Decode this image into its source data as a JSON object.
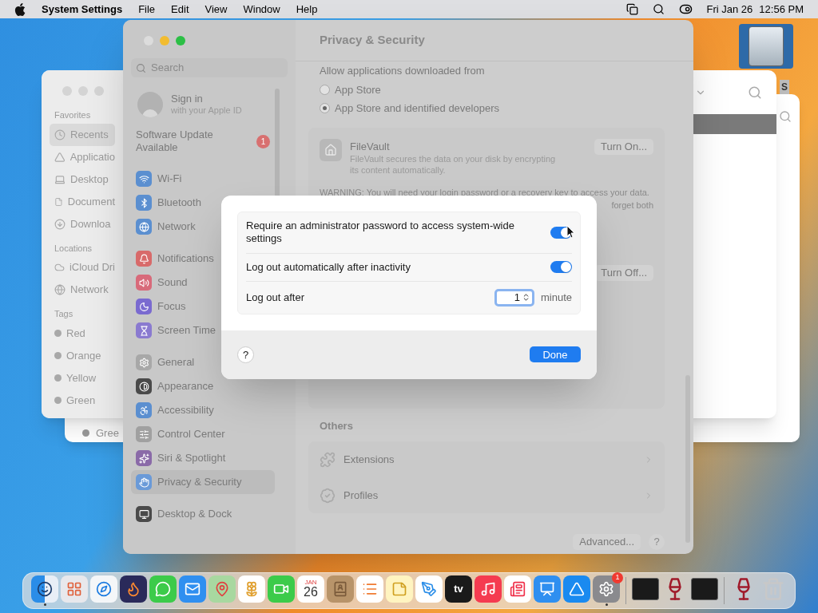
{
  "menu_bar": {
    "app_name": "System Settings",
    "menus": [
      "File",
      "Edit",
      "View",
      "Window",
      "Help"
    ],
    "date": "Fri Jan 26",
    "time": "12:56 PM"
  },
  "desktop": {
    "drive_label": "S"
  },
  "back_window": {
    "tag": "Gree"
  },
  "finder": {
    "sections": [
      {
        "title": "Favorites",
        "items": [
          {
            "label": "Recents",
            "selected": true
          },
          {
            "label": "Applicatio",
            "selected": false
          },
          {
            "label": "Desktop",
            "selected": false
          },
          {
            "label": "Document",
            "selected": false
          },
          {
            "label": "Downloa",
            "selected": false
          }
        ]
      },
      {
        "title": "Locations",
        "items": [
          {
            "label": "iCloud Dri",
            "selected": false
          },
          {
            "label": "Network",
            "selected": false
          }
        ]
      },
      {
        "title": "Tags",
        "items": [
          {
            "label": "Red",
            "selected": false
          },
          {
            "label": "Orange",
            "selected": false
          },
          {
            "label": "Yellow",
            "selected": false
          },
          {
            "label": "Green",
            "selected": false
          }
        ]
      }
    ]
  },
  "settings": {
    "title": "Privacy & Security",
    "sidebar": {
      "search_placeholder": "Search",
      "account_title": "Sign in",
      "account_subtitle": "with your Apple ID",
      "update_label": "Software Update Available",
      "update_badge": "1",
      "groups": [
        [
          {
            "label": "Wi-Fi",
            "color": "#5b8fd0",
            "selected": false
          },
          {
            "label": "Bluetooth",
            "color": "#5b8fd0",
            "selected": false
          },
          {
            "label": "Network",
            "color": "#5b8fd0",
            "selected": false
          }
        ],
        [
          {
            "label": "Notifications",
            "color": "#d86a6a",
            "selected": false
          },
          {
            "label": "Sound",
            "color": "#d86a7a",
            "selected": false
          },
          {
            "label": "Focus",
            "color": "#7a6ad0",
            "selected": false
          },
          {
            "label": "Screen Time",
            "color": "#8a7ad0",
            "selected": false
          }
        ],
        [
          {
            "label": "General",
            "color": "#a8a8a8",
            "selected": false
          },
          {
            "label": "Appearance",
            "color": "#4a4a4a",
            "selected": false
          },
          {
            "label": "Accessibility",
            "color": "#5b8fd0",
            "selected": false
          },
          {
            "label": "Control Center",
            "color": "#a0a0a0",
            "selected": false
          },
          {
            "label": "Siri & Spotlight",
            "color": "#8a6aa8",
            "selected": false
          },
          {
            "label": "Privacy & Security",
            "color": "#6a9ad8",
            "selected": true
          }
        ],
        [
          {
            "label": "Desktop & Dock",
            "color": "#4a4a4a",
            "selected": false
          }
        ]
      ]
    },
    "allow_label": "Allow applications downloaded from",
    "radios": [
      {
        "label": "App Store",
        "selected": false
      },
      {
        "label": "App Store and identified developers",
        "selected": true
      }
    ],
    "filevault": {
      "title": "FileVault",
      "description": "FileVault secures the data on your disk by encrypting its content automatically.",
      "button": "Turn On..."
    },
    "warning": "WARNING: You will need your login password or a recovery key to access your data.",
    "warning_tail": "forget both",
    "lockdown_button": "Turn Off...",
    "others": {
      "title": "Others",
      "rows": [
        "Extensions",
        "Profiles"
      ]
    },
    "advanced_button": "Advanced...",
    "help_button": "?"
  },
  "dialog": {
    "rows": [
      {
        "kind": "toggle",
        "label": "Require an administrator password to access system-wide settings",
        "on": true
      },
      {
        "kind": "toggle",
        "label": "Log out automatically after inactivity",
        "on": true
      },
      {
        "kind": "stepper",
        "label": "Log out after",
        "value": "1",
        "unit": "minute"
      }
    ],
    "help_button": "?",
    "done_button": "Done"
  },
  "dock": {
    "items": [
      {
        "kind": "finder",
        "running": true
      },
      {
        "kind": "launchpad",
        "running": false
      },
      {
        "kind": "safari",
        "running": false
      },
      {
        "kind": "firefox",
        "running": false
      },
      {
        "kind": "messages",
        "running": false
      },
      {
        "kind": "mail",
        "running": false
      },
      {
        "kind": "maps",
        "running": false
      },
      {
        "kind": "photos",
        "running": false
      },
      {
        "kind": "facetime",
        "running": false
      },
      {
        "kind": "calendar",
        "running": false,
        "month": "JAN",
        "day": "26"
      },
      {
        "kind": "contacts",
        "running": false
      },
      {
        "kind": "reminders",
        "running": false
      },
      {
        "kind": "notes",
        "running": false
      },
      {
        "kind": "freeform",
        "running": false
      },
      {
        "kind": "tv",
        "running": false,
        "text": "tv"
      },
      {
        "kind": "music",
        "running": false
      },
      {
        "kind": "news",
        "running": false
      },
      {
        "kind": "keynote",
        "running": false
      },
      {
        "kind": "appstore",
        "running": false
      },
      {
        "kind": "settings",
        "running": true,
        "badge": "1"
      },
      {
        "kind": "separator"
      },
      {
        "kind": "terminal",
        "running": false
      },
      {
        "kind": "wine",
        "running": false
      },
      {
        "kind": "terminal",
        "running": false
      },
      {
        "kind": "separator"
      },
      {
        "kind": "wine",
        "running": false
      },
      {
        "kind": "trash",
        "running": false
      }
    ]
  }
}
